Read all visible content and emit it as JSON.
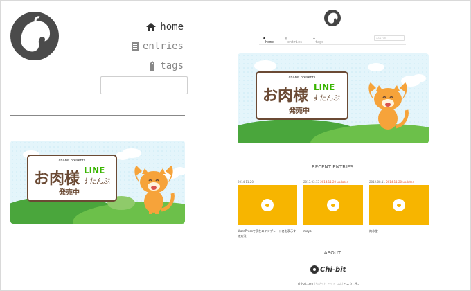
{
  "nav": {
    "items": [
      {
        "label": "home",
        "icon": "home-icon",
        "active": true
      },
      {
        "label": "entries",
        "icon": "document-icon",
        "active": false
      },
      {
        "label": "tags",
        "icon": "tag-icon",
        "active": false
      }
    ],
    "search_value": ""
  },
  "banner": {
    "presents": "chi-bit presents",
    "title": "お肉様",
    "line": "LINE",
    "subtitle": "すたんぷ",
    "sale": "発売中"
  },
  "preview": {
    "nav": {
      "home": "home",
      "entries": "entries",
      "tags": "tags",
      "search_placeholder": "search"
    },
    "recent_heading": "RECENT ENTRIES",
    "about_heading": "ABOUT",
    "entries": [
      {
        "date": "2014.11.20",
        "updated": "",
        "title": "WordPressで現在のテンプレート名を表示する方法"
      },
      {
        "date": "2013.03.13",
        "updated": "2014.11.20 updated",
        "title": "mayo"
      },
      {
        "date": "2012.08.11",
        "updated": "2014.11.20 updated",
        "title": "灼水堂"
      }
    ],
    "brand": "Chi-bit",
    "welcome_host": "chi-bit.com",
    "welcome_host_paren": "(ちびっと ドット コム)",
    "welcome_tail": "へようこそ。"
  },
  "colors": {
    "accent": "#f7b500",
    "logo_dark": "#4b4b4b",
    "brown": "#6b4a34",
    "line_green": "#38b400",
    "updated": "#e6552e",
    "sky": "#dff3fb",
    "hill": "#45a93a"
  }
}
